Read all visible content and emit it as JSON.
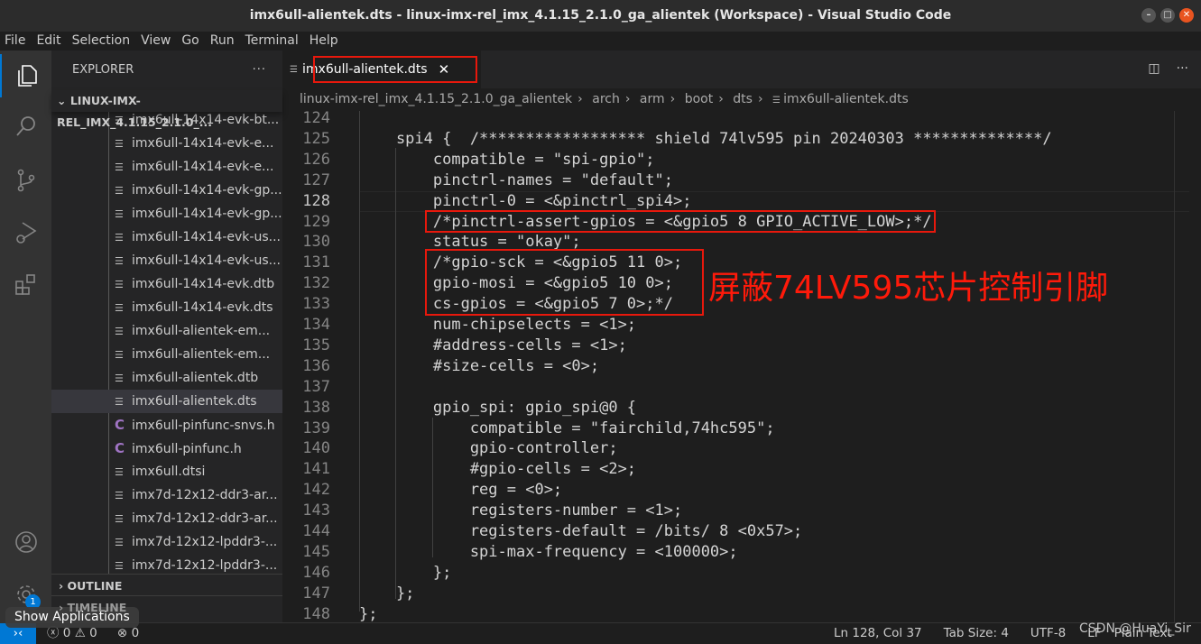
{
  "window": {
    "title": "imx6ull-alientek.dts - linux-imx-rel_imx_4.1.15_2.1.0_ga_alientek (Workspace) - Visual Studio Code"
  },
  "menu": [
    "File",
    "Edit",
    "Selection",
    "View",
    "Go",
    "Run",
    "Terminal",
    "Help"
  ],
  "sidebar": {
    "title": "EXPLORER",
    "more": "···",
    "root": "LINUX-IMX-REL_IMX_4.1.15_2.1.0_...",
    "files": [
      {
        "name": "imx6ull-14x14-evk-bt...",
        "icon": "lines"
      },
      {
        "name": "imx6ull-14x14-evk-e...",
        "icon": "lines"
      },
      {
        "name": "imx6ull-14x14-evk-e...",
        "icon": "lines"
      },
      {
        "name": "imx6ull-14x14-evk-gp...",
        "icon": "lines"
      },
      {
        "name": "imx6ull-14x14-evk-gp...",
        "icon": "lines"
      },
      {
        "name": "imx6ull-14x14-evk-us...",
        "icon": "lines"
      },
      {
        "name": "imx6ull-14x14-evk-us...",
        "icon": "lines"
      },
      {
        "name": "imx6ull-14x14-evk.dtb",
        "icon": "lines"
      },
      {
        "name": "imx6ull-14x14-evk.dts",
        "icon": "lines"
      },
      {
        "name": "imx6ull-alientek-em...",
        "icon": "lines"
      },
      {
        "name": "imx6ull-alientek-em...",
        "icon": "lines"
      },
      {
        "name": "imx6ull-alientek.dtb",
        "icon": "lines"
      },
      {
        "name": "imx6ull-alientek.dts",
        "icon": "lines",
        "selected": true
      },
      {
        "name": "imx6ull-pinfunc-snvs.h",
        "icon": "c"
      },
      {
        "name": "imx6ull-pinfunc.h",
        "icon": "c"
      },
      {
        "name": "imx6ull.dtsi",
        "icon": "lines"
      },
      {
        "name": "imx7d-12x12-ddr3-ar...",
        "icon": "lines"
      },
      {
        "name": "imx7d-12x12-ddr3-ar...",
        "icon": "lines"
      },
      {
        "name": "imx7d-12x12-lpddr3-...",
        "icon": "lines"
      },
      {
        "name": "imx7d-12x12-lpddr3-...",
        "icon": "lines"
      }
    ],
    "outline": "OUTLINE",
    "timeline": "TIMELINE"
  },
  "tab": {
    "label": "imx6ull-alientek.dts",
    "close": "✕"
  },
  "breadcrumb": [
    "linux-imx-rel_imx_4.1.15_2.1.0_ga_alientek",
    "arch",
    "arm",
    "boot",
    "dts",
    "imx6ull-alientek.dts"
  ],
  "editor": {
    "current_line": 128,
    "lines": [
      {
        "n": "124",
        "t": ""
      },
      {
        "n": "125",
        "t": "    spi4 {  /****************** shield 74lv595 pin 20240303 **************/"
      },
      {
        "n": "126",
        "t": "        compatible = \"spi-gpio\";"
      },
      {
        "n": "127",
        "t": "        pinctrl-names = \"default\";"
      },
      {
        "n": "128",
        "t": "        pinctrl-0 = <&pinctrl_spi4>;"
      },
      {
        "n": "129",
        "t": "        /*pinctrl-assert-gpios = <&gpio5 8 GPIO_ACTIVE_LOW>;*/"
      },
      {
        "n": "130",
        "t": "        status = \"okay\";"
      },
      {
        "n": "131",
        "t": "        /*gpio-sck = <&gpio5 11 0>;"
      },
      {
        "n": "132",
        "t": "        gpio-mosi = <&gpio5 10 0>;"
      },
      {
        "n": "133",
        "t": "        cs-gpios = <&gpio5 7 0>;*/"
      },
      {
        "n": "134",
        "t": "        num-chipselects = <1>;"
      },
      {
        "n": "135",
        "t": "        #address-cells = <1>;"
      },
      {
        "n": "136",
        "t": "        #size-cells = <0>;"
      },
      {
        "n": "137",
        "t": ""
      },
      {
        "n": "138",
        "t": "        gpio_spi: gpio_spi@0 {"
      },
      {
        "n": "139",
        "t": "            compatible = \"fairchild,74hc595\";"
      },
      {
        "n": "140",
        "t": "            gpio-controller;"
      },
      {
        "n": "141",
        "t": "            #gpio-cells = <2>;"
      },
      {
        "n": "142",
        "t": "            reg = <0>;"
      },
      {
        "n": "143",
        "t": "            registers-number = <1>;"
      },
      {
        "n": "144",
        "t": "            registers-default = /bits/ 8 <0x57>;"
      },
      {
        "n": "145",
        "t": "            spi-max-frequency = <100000>;"
      },
      {
        "n": "146",
        "t": "        };"
      },
      {
        "n": "147",
        "t": "    };"
      },
      {
        "n": "148",
        "t": "};"
      }
    ]
  },
  "annotation": "屏蔽74LV595芯片控制引脚",
  "status": {
    "errors": "0",
    "warnings": "0",
    "ports": "0",
    "position": "Ln 128, Col 37",
    "tab_size": "Tab Size: 4",
    "encoding": "UTF-8",
    "eol": "LF",
    "language": "Plain Text"
  },
  "notifications_badge": "1",
  "tooltip": "Show Applications",
  "watermark": "CSDN @HuaYi_Sir",
  "colors": {
    "accent": "#0078d4",
    "annotation": "#e8180c"
  }
}
